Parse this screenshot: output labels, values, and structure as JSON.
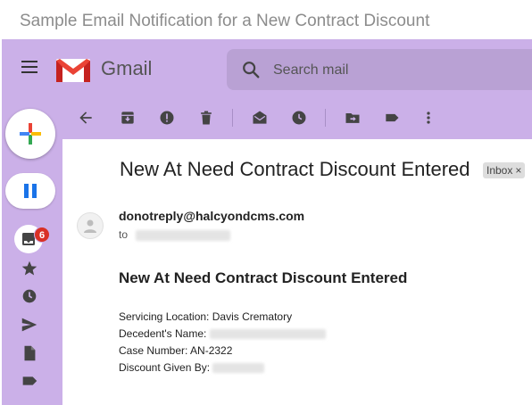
{
  "caption": "Sample Email Notification for a New Contract Discount",
  "header": {
    "brand": "Gmail",
    "search_placeholder": "Search mail"
  },
  "sidebar": {
    "inbox_badge": "6",
    "icons": [
      "compose-plus-icon",
      "pause-icon",
      "inbox-icon",
      "star-icon",
      "clock-icon",
      "send-icon",
      "file-icon",
      "label-icon"
    ]
  },
  "toolbar": {
    "icons": [
      "back-arrow-icon",
      "archive-icon",
      "report-spam-icon",
      "delete-icon",
      "mark-unread-icon",
      "snooze-icon",
      "move-to-icon",
      "label-icon",
      "more-vert-icon"
    ]
  },
  "email": {
    "subject": "New At Need Contract Discount Entered",
    "tag": "Inbox",
    "tag_close": "×",
    "sender": "donotreply@halcyondcms.com",
    "to_label": "to",
    "body_heading": "New At Need Contract Discount Entered",
    "fields": [
      {
        "label": "Servicing Location:",
        "value": "Davis Crematory"
      },
      {
        "label": "Decedent's Name:",
        "value": ""
      },
      {
        "label": "Case Number:",
        "value": "AN-2322"
      },
      {
        "label": "Discount Given By:",
        "value": ""
      }
    ]
  },
  "colors": {
    "chrome": "#cbb0e8",
    "search_bg": "#b9a1d4",
    "badge": "#d93025",
    "gmail_red": "#ea4335"
  }
}
